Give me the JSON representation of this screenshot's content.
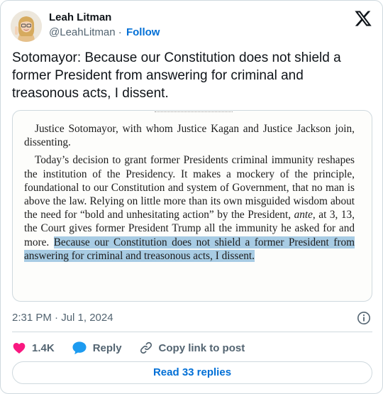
{
  "tweet": {
    "author_name": "Leah Litman",
    "handle": "@LeahLitman",
    "separator": "·",
    "follow_label": "Follow",
    "text": "Sotomayor: Because our Constitution does not shield a former President from answering for criminal and treasonous acts, I dissent.",
    "timestamp": "2:31 PM · Jul 1, 2024"
  },
  "media": {
    "para1": "Justice Sotomayor, with whom Justice Kagan and Justice Jackson join, dissenting.",
    "para2_plain": "Today’s decision to grant former Presidents criminal immunity reshapes the institution of the Presidency. It makes a mockery of the principle, foundational to our Constitution and system of Government, that no man is above the law. Relying on little more than its own misguided wisdom about the need for “bold and unhesitating action” by the President, ",
    "para2_ante": "ante,",
    "para2_mid": " at 3, 13, the Court gives former President Trump all the immunity he asked for and more. ",
    "para2_highlight": "Because our Constitution does not shield a former President from answering for criminal and treasonous acts, I dissent."
  },
  "actions": {
    "like_count": "1.4K",
    "reply_label": "Reply",
    "copy_label": "Copy link to post",
    "read_replies_label": "Read 33 replies"
  },
  "icons": {
    "logo": "x-logo-icon",
    "info": "info-icon",
    "like": "heart-icon",
    "reply": "speech-bubble-icon",
    "copy": "link-icon"
  },
  "colors": {
    "accent": "#006fd6",
    "like": "#f91880",
    "reply": "#1d9bf0",
    "highlight": "#a8cce4",
    "muted": "#536471"
  }
}
